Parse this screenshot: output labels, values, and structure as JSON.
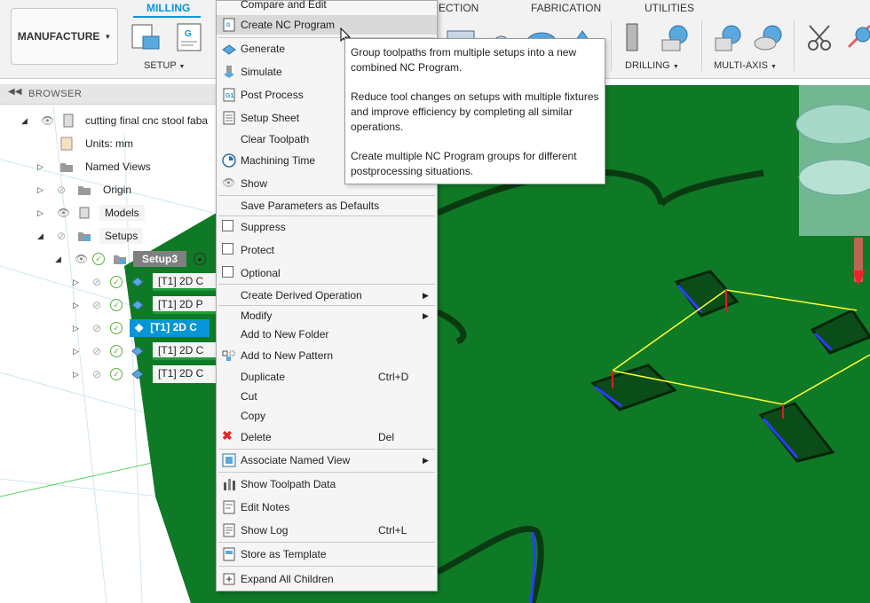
{
  "toolbar": {
    "workspace": "MANUFACTURE",
    "tabs": [
      "MILLING",
      "INSPECTION",
      "FABRICATION",
      "UTILITIES"
    ],
    "groups": [
      "SETUP",
      "DRILLING",
      "MULTI-AXIS"
    ]
  },
  "browser": {
    "title": "BROWSER",
    "root": "cutting final cnc stool faba",
    "units": "Units: mm",
    "named_views": "Named Views",
    "origin": "Origin",
    "models": "Models",
    "setups": "Setups",
    "setup3": "Setup3",
    "operations": [
      "[T1] 2D C",
      "[T1] 2D P",
      "[T1] 2D C",
      "[T1] 2D C",
      "[T1] 2D C"
    ]
  },
  "context_menu": {
    "items": [
      {
        "label": "Compare and Edit"
      },
      {
        "label": "Create NC Program"
      },
      {
        "label": "Generate"
      },
      {
        "label": "Simulate"
      },
      {
        "label": "Post Process"
      },
      {
        "label": "Setup Sheet"
      },
      {
        "label": "Clear Toolpath"
      },
      {
        "label": "Machining Time"
      },
      {
        "label": "Show"
      },
      {
        "label": "Save Parameters as Defaults"
      },
      {
        "label": "Suppress"
      },
      {
        "label": "Protect"
      },
      {
        "label": "Optional"
      },
      {
        "label": "Create Derived Operation"
      },
      {
        "label": "Modify"
      },
      {
        "label": "Add to New Folder"
      },
      {
        "label": "Add to New Pattern"
      },
      {
        "label": "Duplicate",
        "shortcut": "Ctrl+D"
      },
      {
        "label": "Cut"
      },
      {
        "label": "Copy"
      },
      {
        "label": "Delete",
        "shortcut": "Del"
      },
      {
        "label": "Associate Named View"
      },
      {
        "label": "Show Toolpath Data"
      },
      {
        "label": "Edit Notes"
      },
      {
        "label": "Show Log",
        "shortcut": "Ctrl+L"
      },
      {
        "label": "Store as Template"
      },
      {
        "label": "Expand All Children"
      }
    ]
  },
  "tooltip": {
    "paragraphs": [
      "Group toolpaths from multiple setups into a new combined NC Program.",
      "Reduce tool changes on setups with multiple fixtures and improve efficiency by completing all similar operations.",
      "Create multiple NC Program groups for different postprocessing situations."
    ]
  },
  "colors": {
    "accent": "#0696d7",
    "part": "#0f7a26",
    "toolpath": "#ffff33",
    "delete": "#e8262b"
  }
}
